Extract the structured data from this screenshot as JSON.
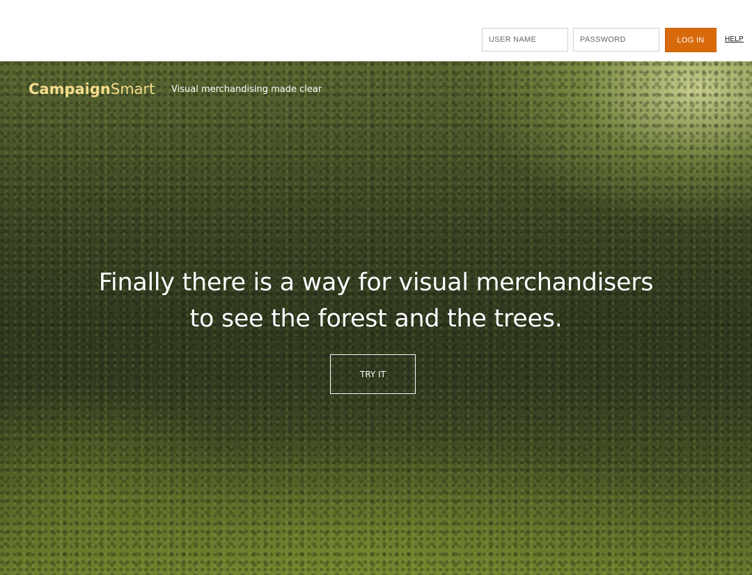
{
  "login": {
    "username_placeholder": "USER NAME",
    "password_placeholder": "PASSWORD",
    "login_label": "LOG IN",
    "help_label": "HELP",
    "login_button_color": "#d96a0c"
  },
  "brand": {
    "name_bold": "Campaign",
    "name_regular": "Smart",
    "tagline": "Visual merchandising made clear",
    "brand_color": "#f5dc8c"
  },
  "hero": {
    "headline_line1": "Finally there is a way for visual merchandisers",
    "headline_line2": "to see the forest and the trees.",
    "cta_label": "TRY IT",
    "background": "forest-aerial-photo"
  }
}
